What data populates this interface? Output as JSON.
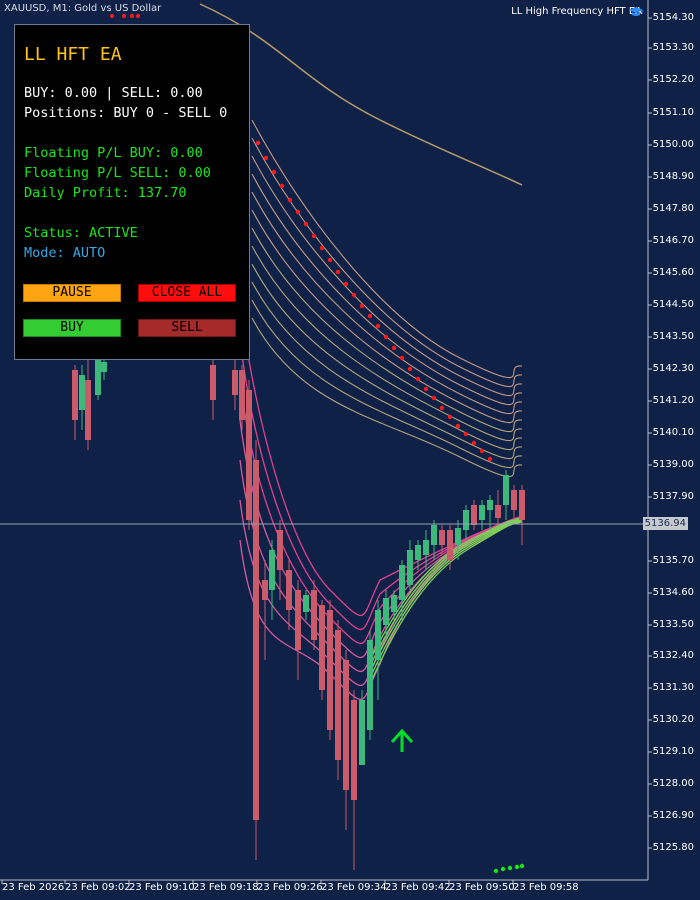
{
  "header": {
    "symbol_text": "XAUUSD, M1:  Gold vs US Dollar",
    "ea_name": "LL High Frequency HFT EA"
  },
  "panel": {
    "title": "LL HFT EA",
    "buy_sell_line": "BUY: 0.00 | SELL: 0.00",
    "positions_line": "Positions: BUY 0 - SELL 0",
    "floating_buy": "Floating P/L BUY: 0.00",
    "floating_sell": "Floating P/L SELL: 0.00",
    "daily_profit": "Daily Profit: 137.70",
    "status": "Status: ACTIVE",
    "mode": "Mode: AUTO",
    "pause_label": "PAUSE",
    "close_all_label": "CLOSE ALL",
    "buy_label": "BUY",
    "sell_label": "SELL"
  },
  "price_axis": {
    "labels": [
      "5154.30",
      "5153.30",
      "5152.20",
      "5151.10",
      "5150.00",
      "5148.90",
      "5147.80",
      "5146.70",
      "5145.60",
      "5144.50",
      "5143.50",
      "5142.30",
      "5141.20",
      "5140.10",
      "5139.00",
      "5137.90",
      "5135.70",
      "5134.60",
      "5133.50",
      "5132.40",
      "5131.30",
      "5130.20",
      "5129.10",
      "5128.00",
      "5126.90",
      "5125.80"
    ],
    "current_price": "5136.94"
  },
  "time_axis": {
    "labels": [
      "23 Feb 2026",
      "23 Feb 09:02",
      "23 Feb 09:10",
      "23 Feb 09:18",
      "23 Feb 09:26",
      "23 Feb 09:34",
      "23 Feb 09:42",
      "23 Feb 09:50",
      "23 Feb 09:58"
    ]
  },
  "colors": {
    "background": "#0f2147",
    "bull_candle": "#3fb87b",
    "bear_candle": "#c95b6a",
    "signal_arrow": "#00e02a",
    "sell_dots": "#ff1a1a",
    "buy_dots": "#19e619"
  }
}
